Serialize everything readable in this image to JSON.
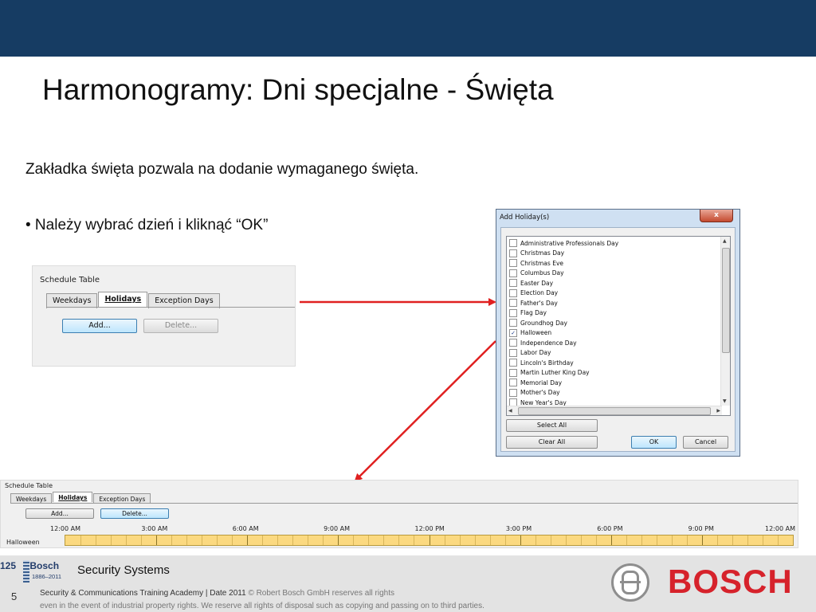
{
  "slide": {
    "title": "Harmonogramy: Dni specjalne - Święta",
    "intro": "Zakładka święta pozwala na dodanie wymaganego święta.",
    "bullet": "• Należy wybrać dzień i kliknąć “OK”"
  },
  "schedule_table_top": {
    "caption": "Schedule Table",
    "tabs": [
      "Weekdays",
      "Holidays",
      "Exception Days"
    ],
    "active_tab": "Holidays",
    "add_label": "Add...",
    "delete_label": "Delete..."
  },
  "dialog": {
    "title": "Add Holiday(s)",
    "close_label": "x",
    "holidays": [
      {
        "name": "Administrative Professionals Day",
        "checked": false
      },
      {
        "name": "Christmas Day",
        "checked": false
      },
      {
        "name": "Christmas Eve",
        "checked": false
      },
      {
        "name": "Columbus Day",
        "checked": false
      },
      {
        "name": "Easter Day",
        "checked": false
      },
      {
        "name": "Election Day",
        "checked": false
      },
      {
        "name": "Father's Day",
        "checked": false
      },
      {
        "name": "Flag Day",
        "checked": false
      },
      {
        "name": "Groundhog Day",
        "checked": false
      },
      {
        "name": "Halloween",
        "checked": true
      },
      {
        "name": "Independence Day",
        "checked": false
      },
      {
        "name": "Labor Day",
        "checked": false
      },
      {
        "name": "Lincoln's Birthday",
        "checked": false
      },
      {
        "name": "Martin Luther King Day",
        "checked": false
      },
      {
        "name": "Memorial Day",
        "checked": false
      },
      {
        "name": "Mother's Day",
        "checked": false
      },
      {
        "name": "New Year's Day",
        "checked": false
      }
    ],
    "select_all_label": "Select All",
    "clear_all_label": "Clear All",
    "ok_label": "OK",
    "cancel_label": "Cancel"
  },
  "schedule_table_bottom": {
    "caption": "Schedule Table",
    "tabs": [
      "Weekdays",
      "Holidays",
      "Exception Days"
    ],
    "active_tab": "Holidays",
    "add_label": "Add...",
    "delete_label": "Delete...",
    "times": [
      "12:00 AM",
      "3:00 AM",
      "6:00 AM",
      "9:00 AM",
      "12:00 PM",
      "3:00 PM",
      "6:00 PM",
      "9:00 PM",
      "12:00 AM"
    ],
    "holiday_row": "Halloween"
  },
  "footer": {
    "anniversary_number": "125",
    "anniversary_brand": "Bosch",
    "anniversary_years": "1886–2011",
    "division": "Security Systems",
    "page_number": "5",
    "academy": "Security & Communications Training Academy | Date 2011",
    "copyright": "© Robert Bosch GmbH reserves all rights",
    "disclaimer": "even in the event of industrial property rights. We reserve all rights of disposal such as copying and passing on to third parties.",
    "brand": "BOSCH"
  },
  "colors": {
    "header_bar": "#163c63",
    "arrow": "#e02020",
    "timeline": "#fbd980",
    "brand_red": "#d6222b"
  }
}
